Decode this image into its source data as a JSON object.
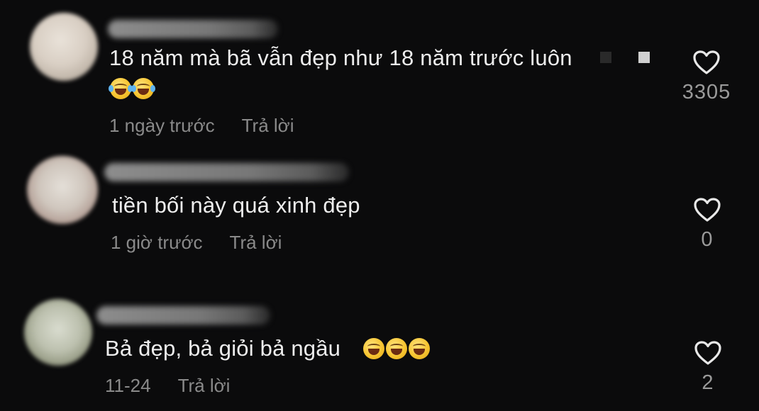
{
  "comments": [
    {
      "text": "18 năm mà bã vẫn đẹp như 18 năm trước luôn",
      "emojis": [
        "face-with-tears-of-joy",
        "face-with-tears-of-joy"
      ],
      "time": "1 ngày trước",
      "reply": "Trả lời",
      "likes": "3305"
    },
    {
      "text": "tiền bối này quá xinh đẹp",
      "emojis": [],
      "time": "1 giờ trước",
      "reply": "Trả lời",
      "likes": "0"
    },
    {
      "text": "Bả đẹp, bả giỏi bả ngầu",
      "emojis": [
        "grinning-squinting-face",
        "grinning-squinting-face",
        "grinning-squinting-face"
      ],
      "time": "11-24",
      "reply": "Trả lời",
      "likes": "2"
    }
  ],
  "icons": {
    "like": "heart-outline-icon"
  },
  "colors": {
    "background": "#0b0b0c",
    "text": "#ededed",
    "meta": "#8a8a8a"
  }
}
